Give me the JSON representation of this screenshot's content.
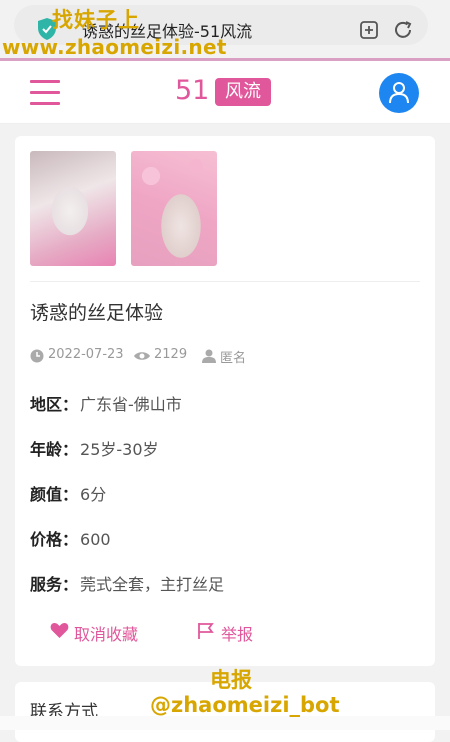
{
  "browser": {
    "url_title": "诱惑的丝足体验-51风流"
  },
  "watermark": {
    "site_name": "找妹子上",
    "site_url": "www.zhaomeizi.net",
    "telegram_label": "电报",
    "telegram_handle": "@zhaomeizi_bot"
  },
  "header": {
    "logo_number": "51",
    "logo_text": "风流"
  },
  "post": {
    "title": "诱惑的丝足体验",
    "date": "2022-07-23",
    "views": "2129",
    "author": "匿名",
    "fields": [
      {
        "key": "地区：",
        "value": "广东省-佛山市"
      },
      {
        "key": "年龄：",
        "value": "25岁-30岁"
      },
      {
        "key": "颜值：",
        "value": "6分"
      },
      {
        "key": "价格：",
        "value": "600"
      },
      {
        "key": "服务：",
        "value": "莞式全套，主打丝足"
      }
    ],
    "actions": {
      "unfavorite": "取消收藏",
      "report": "举报"
    }
  },
  "contact": {
    "title": "联系方式"
  },
  "colors": {
    "accent": "#e0579b",
    "user_button": "#1d86f0",
    "watermark": "#d8a600"
  },
  "icons": [
    "shield-icon",
    "add-tab-icon",
    "refresh-icon",
    "menu-icon",
    "user-icon",
    "clock-icon",
    "eye-icon",
    "person-icon",
    "heart-icon",
    "flag-icon"
  ]
}
